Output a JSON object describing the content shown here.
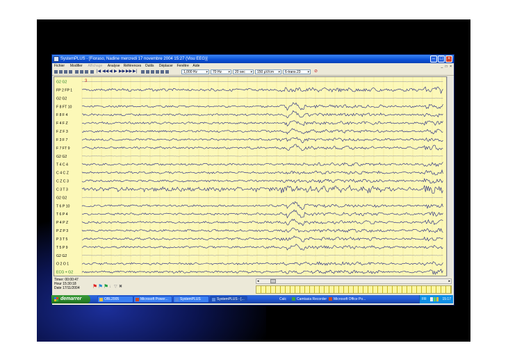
{
  "window": {
    "title": "SystemPLUS - [Fioraso, Nadine mercredi 17 novembre 2004 15:27 (Visu EEG)]"
  },
  "menu": [
    {
      "label": "Fichier",
      "dim": false
    },
    {
      "label": "Modifier",
      "dim": false
    },
    {
      "label": "Affichage",
      "dim": true
    },
    {
      "label": "Analyse",
      "dim": false
    },
    {
      "label": "Références",
      "dim": false
    },
    {
      "label": "Outils",
      "dim": false
    },
    {
      "label": "Déplacer",
      "dim": false
    },
    {
      "label": "Fenêtre",
      "dim": false
    },
    {
      "label": "Aide",
      "dim": false
    }
  ],
  "toolbar": {
    "combos": [
      {
        "name": "low-filter-select",
        "value": "1,000 Hz"
      },
      {
        "name": "high-filter-select",
        "value": "70 Hz"
      },
      {
        "name": "timebase-select",
        "value": "20 sec"
      },
      {
        "name": "gain-select",
        "value": "150 µV/cm"
      },
      {
        "name": "montage-select",
        "value": "6-trans.23"
      }
    ]
  },
  "eeg": {
    "marker": "3",
    "channels": [
      "G2 G2",
      "FP 2 FP 1",
      "G2 G2",
      "F 8 FT 10",
      "F 8 F 4",
      "F 4 F Z",
      "F Z F 3",
      "F 3 F 7",
      "F 7 FT 9",
      "G2 G2",
      "T 4 C 4",
      "C 4 C Z",
      "C Z C 3",
      "C 3 T 3",
      "G2 G2",
      "T 6 P 10",
      "T 6 P 4",
      "P 4 P Z",
      "P Z P 3",
      "P 3 T 5",
      "T 5 P 9",
      "G2 G2",
      "O 2 O 1",
      "ECG + G2"
    ],
    "colors": {
      "trace": "#1a1f80",
      "background": "#fcf8b8"
    }
  },
  "status": {
    "timer": "Timer: 00:00:47",
    "hour": "Hour    15:30:18",
    "date": "Date    17/11/2004"
  },
  "taskbar": {
    "start": "demarrer",
    "tasks": [
      {
        "label": "OBL2005",
        "icon": "#e8c040"
      },
      {
        "label": "Microsoft Power...",
        "icon": "#d04a20"
      },
      {
        "label": "SystemPLUS",
        "icon": "#5a8ae0"
      },
      {
        "label": "SystemPLUS - [...",
        "icon": "#5a8ae0"
      }
    ],
    "quick": [
      {
        "label": "Calc",
        "icon": ""
      },
      {
        "label": "Camtasia Recorder",
        "icon": "#40a040"
      },
      {
        "label": "Microsoft Office Po...",
        "icon": "#d04a20"
      }
    ],
    "tray": {
      "lang": "FR",
      "clock": "15:17"
    }
  }
}
